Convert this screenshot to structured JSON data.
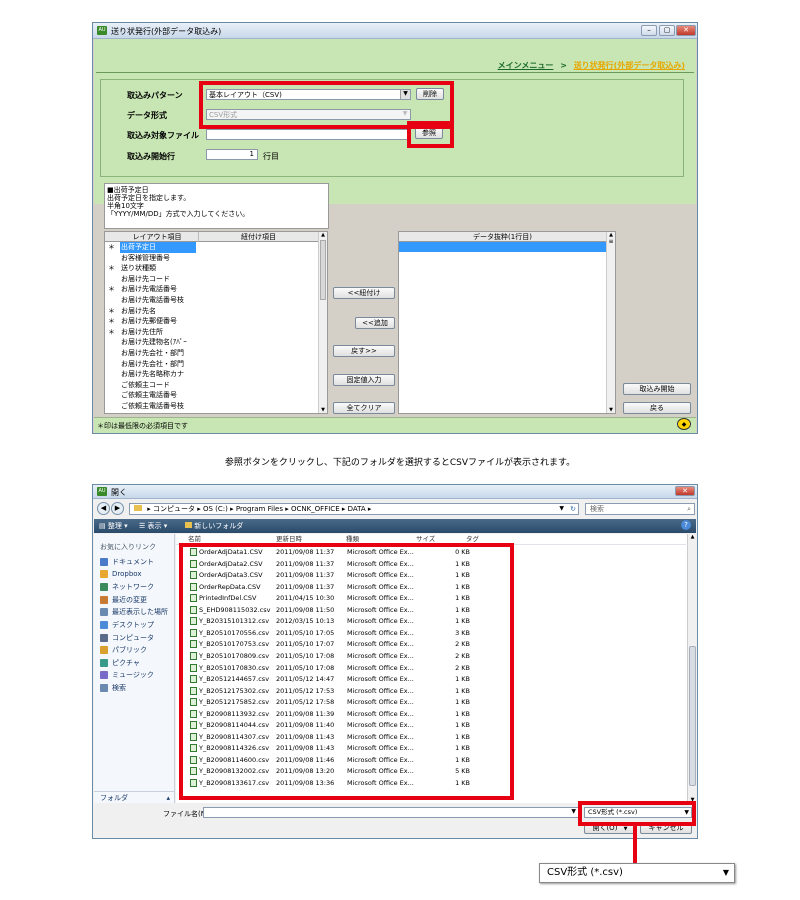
{
  "win1": {
    "title": "送り状発行(外部データ取込み)",
    "breadcrumb": {
      "menu": "メインメニュー",
      "sep": ">",
      "current": "送り状発行(外部データ取込み)"
    },
    "form": {
      "pattern_label": "取込みパターン",
      "pattern_value": "基本レイアウト（CSV)",
      "delete_button": "削除",
      "format_label": "データ形式",
      "format_value": "CSV形式",
      "file_label": "取込み対象ファイル",
      "file_value": "",
      "browse_button": "参照",
      "start_label": "取込み開始行",
      "start_value": "1",
      "start_unit": "行目"
    },
    "help_lines": [
      "■出荷予定日",
      "出荷予定日を指定します。",
      "半角10文字",
      "「YYYY/MM/DD」方式で入力してください。"
    ],
    "layout_list": {
      "col1": "レイアウト項目",
      "col2": "紐付け項目",
      "rows": [
        {
          "mark": "＊",
          "name": "出荷予定日"
        },
        {
          "mark": "",
          "name": "お客様管理番号"
        },
        {
          "mark": "＊",
          "name": "送り状種類"
        },
        {
          "mark": "",
          "name": "お届け先コード"
        },
        {
          "mark": "＊",
          "name": "お届け先電話番号"
        },
        {
          "mark": "",
          "name": "お届け先電話番号枝"
        },
        {
          "mark": "＊",
          "name": "お届け先名"
        },
        {
          "mark": "＊",
          "name": "お届け先郵便番号"
        },
        {
          "mark": "＊",
          "name": "お届け先住所"
        },
        {
          "mark": "",
          "name": "お届け先建物名(ｱﾊﾟｰ"
        },
        {
          "mark": "",
          "name": "お届け先会社・部門"
        },
        {
          "mark": "",
          "name": "お届け先会社・部門"
        },
        {
          "mark": "",
          "name": "お届け先名略称カナ"
        },
        {
          "mark": "",
          "name": "ご依頼主コード"
        },
        {
          "mark": "",
          "name": "ご依頼主電話番号"
        },
        {
          "mark": "",
          "name": "ご依頼主電話番号枝"
        },
        {
          "mark": "",
          "name": "ご依頼主名"
        }
      ]
    },
    "mid_buttons": [
      "<<紐付け",
      "<<追加",
      "戻す>>",
      "固定値入力",
      "全てクリア"
    ],
    "data_list": {
      "header": "データ抜粋(1行目)"
    },
    "right_buttons": [
      "取込み開始",
      "戻る"
    ],
    "footer_note": "＊印は最低限の必須項目です"
  },
  "caption": "参照ボタンをクリックし、下記のフォルダを選択するとCSVファイルが表示されます。",
  "win2": {
    "title": "開く",
    "path": [
      "コンピュータ",
      "OS (C:)",
      "Program Files",
      "OCNK_OFFICE",
      "DATA"
    ],
    "search_placeholder": "検索",
    "toolbar": {
      "organize": "整理",
      "views": "表示",
      "new_folder": "新しいフォルダ"
    },
    "nav_title": "お気に入りリンク",
    "nav": [
      "ドキュメント",
      "Dropbox",
      "ネットワーク",
      "最近の変更",
      "最近表示した場所",
      "デスクトップ",
      "コンピュータ",
      "パブリック",
      "ピクチャ",
      "ミュージック",
      "検索"
    ],
    "folder_label": "フォルダ",
    "columns": [
      "名前",
      "更新日時",
      "種類",
      "サイズ",
      "タグ"
    ],
    "files": [
      {
        "name": "OrderAdjData1.CSV",
        "date": "2011/09/08 11:37",
        "type": "Microsoft Office Ex...",
        "size": "0 KB"
      },
      {
        "name": "OrderAdjData2.CSV",
        "date": "2011/09/08 11:37",
        "type": "Microsoft Office Ex...",
        "size": "1 KB"
      },
      {
        "name": "OrderAdjData3.CSV",
        "date": "2011/09/08 11:37",
        "type": "Microsoft Office Ex...",
        "size": "1 KB"
      },
      {
        "name": "OrderRepData.CSV",
        "date": "2011/09/08 11:37",
        "type": "Microsoft Office Ex...",
        "size": "1 KB"
      },
      {
        "name": "PrintedInfDel.CSV",
        "date": "2011/04/15 10:30",
        "type": "Microsoft Office Ex...",
        "size": "1 KB"
      },
      {
        "name": "S_EHD908115032.csv",
        "date": "2011/09/08 11:50",
        "type": "Microsoft Office Ex...",
        "size": "1 KB"
      },
      {
        "name": "Y_B20315101312.csv",
        "date": "2012/03/15 10:13",
        "type": "Microsoft Office Ex...",
        "size": "1 KB"
      },
      {
        "name": "Y_B20510170556.csv",
        "date": "2011/05/10 17:05",
        "type": "Microsoft Office Ex...",
        "size": "3 KB"
      },
      {
        "name": "Y_B20510170753.csv",
        "date": "2011/05/10 17:07",
        "type": "Microsoft Office Ex...",
        "size": "2 KB"
      },
      {
        "name": "Y_B20510170809.csv",
        "date": "2011/05/10 17:08",
        "type": "Microsoft Office Ex...",
        "size": "2 KB"
      },
      {
        "name": "Y_B20510170830.csv",
        "date": "2011/05/10 17:08",
        "type": "Microsoft Office Ex...",
        "size": "2 KB"
      },
      {
        "name": "Y_B20512144657.csv",
        "date": "2011/05/12 14:47",
        "type": "Microsoft Office Ex...",
        "size": "1 KB"
      },
      {
        "name": "Y_B20512175302.csv",
        "date": "2011/05/12 17:53",
        "type": "Microsoft Office Ex...",
        "size": "1 KB"
      },
      {
        "name": "Y_B20512175852.csv",
        "date": "2011/05/12 17:58",
        "type": "Microsoft Office Ex...",
        "size": "1 KB"
      },
      {
        "name": "Y_B20908113932.csv",
        "date": "2011/09/08 11:39",
        "type": "Microsoft Office Ex...",
        "size": "1 KB"
      },
      {
        "name": "Y_B20908114044.csv",
        "date": "2011/09/08 11:40",
        "type": "Microsoft Office Ex...",
        "size": "1 KB"
      },
      {
        "name": "Y_B20908114307.csv",
        "date": "2011/09/08 11:43",
        "type": "Microsoft Office Ex...",
        "size": "1 KB"
      },
      {
        "name": "Y_B20908114326.csv",
        "date": "2011/09/08 11:43",
        "type": "Microsoft Office Ex...",
        "size": "1 KB"
      },
      {
        "name": "Y_B20908114600.csv",
        "date": "2011/09/08 11:46",
        "type": "Microsoft Office Ex...",
        "size": "1 KB"
      },
      {
        "name": "Y_B20908132002.csv",
        "date": "2011/09/08 13:20",
        "type": "Microsoft Office Ex...",
        "size": "5 KB"
      },
      {
        "name": "Y_B20908133617.csv",
        "date": "2011/09/08 13:36",
        "type": "Microsoft Office Ex...",
        "size": "1 KB"
      }
    ],
    "filename_label": "ファイル名(N):",
    "filetype_value": "CSV形式 (*.csv)",
    "open_button": "開く(O)",
    "cancel_button": "キャンセル"
  },
  "callout_value": "CSV形式 (*.csv)",
  "colors": {
    "green_panel": "#c8e6b4",
    "highlight": "#e60012",
    "selection": "#3399ff"
  }
}
